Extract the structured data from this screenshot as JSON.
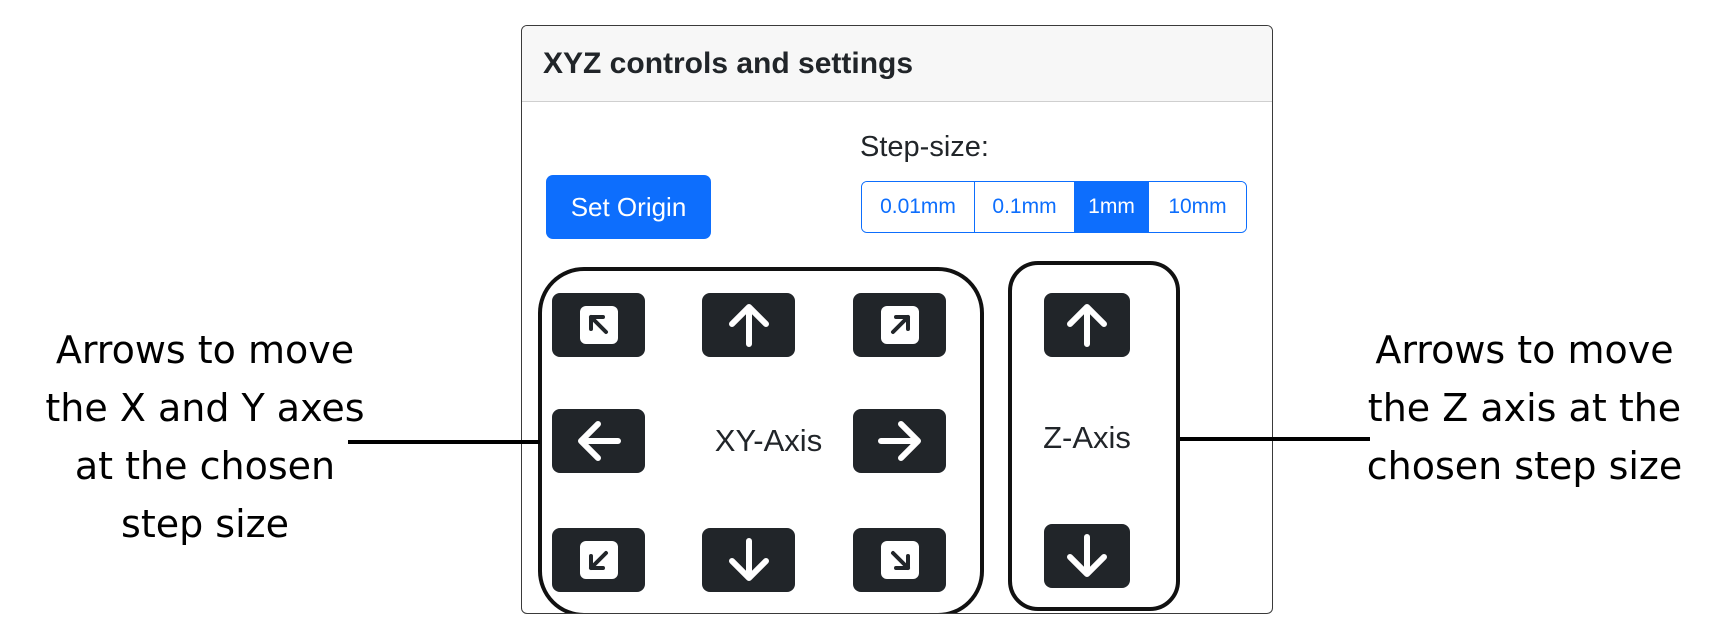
{
  "panel": {
    "title": "XYZ controls and settings",
    "set_origin_label": "Set Origin",
    "step_size_label": "Step-size:",
    "step_sizes": [
      "0.01mm",
      "0.1mm",
      "1mm",
      "10mm"
    ],
    "selected_step_size": "1mm",
    "xy_axis_label": "XY-Axis",
    "z_axis_label": "Z-Axis"
  },
  "annotations": {
    "left": [
      "Arrows to move",
      "the X and Y axes",
      "at the chosen",
      "step size"
    ],
    "right": [
      "Arrows to move",
      "the Z axis at the",
      "chosen step size"
    ]
  },
  "icons": {
    "xy": [
      "arrow-up-left-square-icon",
      "arrow-up-icon",
      "arrow-up-right-square-icon",
      "arrow-left-icon",
      "arrow-right-icon",
      "arrow-down-left-square-icon",
      "arrow-down-icon",
      "arrow-down-right-square-icon"
    ],
    "z": [
      "arrow-up-icon",
      "arrow-down-icon"
    ]
  },
  "colors": {
    "primary": "#0d6efd",
    "dark_button": "#212529"
  }
}
